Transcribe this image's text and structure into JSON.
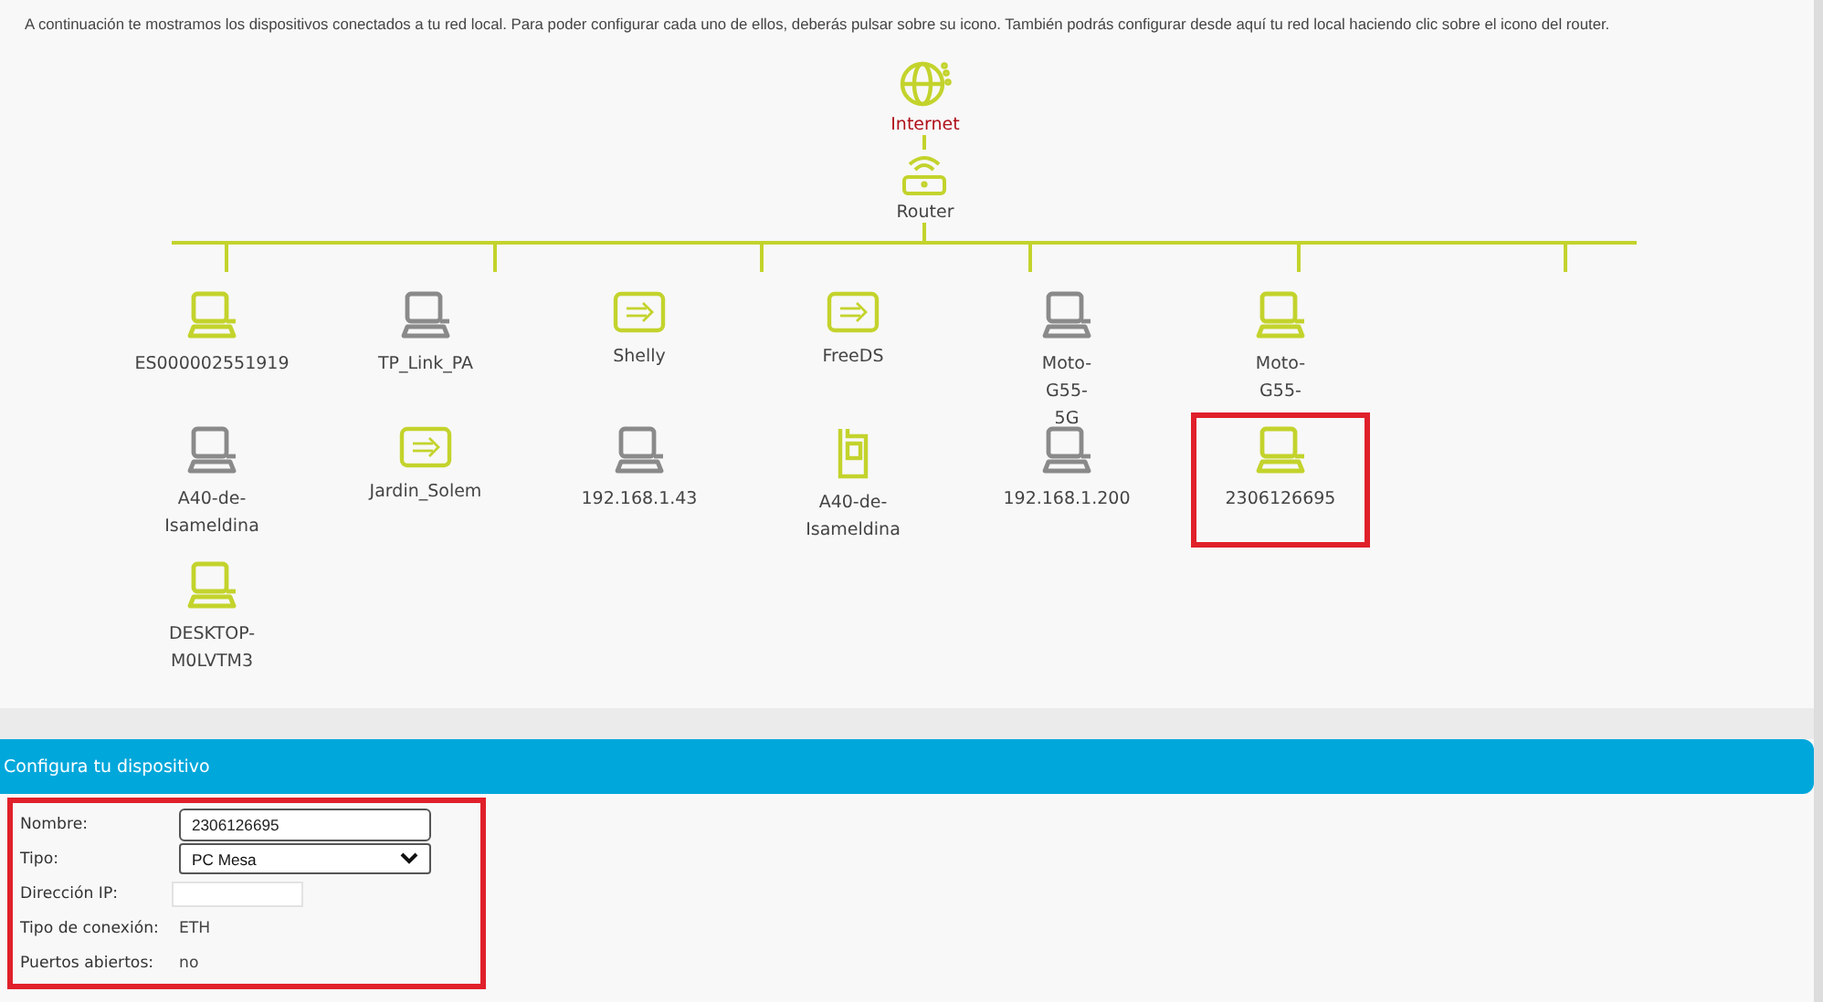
{
  "intro": "A continuación te mostramos los dispositivos conectados a tu red local. Para poder configurar cada uno de ellos, deberás pulsar sobre su icono. También podrás configurar desde aquí tu red local haciendo clic sobre el icono del router.",
  "internet": {
    "label": "Internet"
  },
  "router": {
    "label": "Router"
  },
  "devices": [
    {
      "name": "ES000002551919",
      "kind": "computer",
      "active": true,
      "highlighted": false
    },
    {
      "name": "TP_Link_PA",
      "kind": "computer",
      "active": false,
      "highlighted": false
    },
    {
      "name": "Shelly",
      "kind": "plug",
      "active": true,
      "highlighted": false
    },
    {
      "name": "FreeDS",
      "kind": "plug",
      "active": true,
      "highlighted": false
    },
    {
      "name": "Moto-G55-5G",
      "kind": "computer",
      "active": false,
      "highlighted": false
    },
    {
      "name": "Moto-G55-",
      "kind": "computer",
      "active": true,
      "highlighted": false
    },
    {
      "name": "A40-de-Isameldina",
      "kind": "computer",
      "active": false,
      "highlighted": false
    },
    {
      "name": "Jardin_Solem",
      "kind": "plug",
      "active": true,
      "highlighted": false
    },
    {
      "name": "192.168.1.43",
      "kind": "computer",
      "active": false,
      "highlighted": false
    },
    {
      "name": "A40-de-Isameldina",
      "kind": "phone",
      "active": true,
      "highlighted": false
    },
    {
      "name": "192.168.1.200",
      "kind": "computer",
      "active": false,
      "highlighted": false
    },
    {
      "name": "2306126695",
      "kind": "computer",
      "active": true,
      "highlighted": true
    },
    {
      "name": "DESKTOP-M0LVTM3",
      "kind": "computer",
      "active": true,
      "highlighted": false
    }
  ],
  "config": {
    "title": "Configura tu dispositivo",
    "highlighted": true,
    "fields": [
      {
        "label": "Nombre:",
        "kind": "input",
        "value": "2306126695"
      },
      {
        "label": "Tipo:",
        "kind": "select",
        "value": "PC Mesa"
      },
      {
        "label": "Dirección IP:",
        "kind": "hidden"
      },
      {
        "label": "Tipo de conexión:",
        "kind": "text",
        "value": "ETH"
      },
      {
        "label": "Puertos abiertos:",
        "kind": "text",
        "value": "no"
      }
    ]
  }
}
